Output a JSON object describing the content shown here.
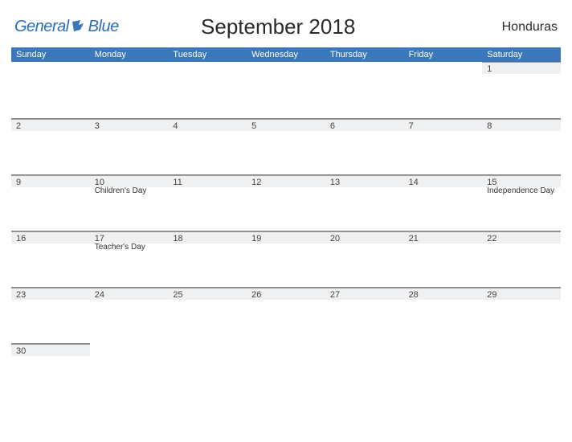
{
  "logo": {
    "part1": "General",
    "part2": "Blue"
  },
  "title": "September 2018",
  "country": "Honduras",
  "weekdays": [
    "Sunday",
    "Monday",
    "Tuesday",
    "Wednesday",
    "Thursday",
    "Friday",
    "Saturday"
  ],
  "weeks": [
    [
      {
        "num": "",
        "event": ""
      },
      {
        "num": "",
        "event": ""
      },
      {
        "num": "",
        "event": ""
      },
      {
        "num": "",
        "event": ""
      },
      {
        "num": "",
        "event": ""
      },
      {
        "num": "",
        "event": ""
      },
      {
        "num": "1",
        "event": ""
      }
    ],
    [
      {
        "num": "2",
        "event": ""
      },
      {
        "num": "3",
        "event": ""
      },
      {
        "num": "4",
        "event": ""
      },
      {
        "num": "5",
        "event": ""
      },
      {
        "num": "6",
        "event": ""
      },
      {
        "num": "7",
        "event": ""
      },
      {
        "num": "8",
        "event": ""
      }
    ],
    [
      {
        "num": "9",
        "event": ""
      },
      {
        "num": "10",
        "event": "Children's Day"
      },
      {
        "num": "11",
        "event": ""
      },
      {
        "num": "12",
        "event": ""
      },
      {
        "num": "13",
        "event": ""
      },
      {
        "num": "14",
        "event": ""
      },
      {
        "num": "15",
        "event": "Independence Day"
      }
    ],
    [
      {
        "num": "16",
        "event": ""
      },
      {
        "num": "17",
        "event": "Teacher's Day"
      },
      {
        "num": "18",
        "event": ""
      },
      {
        "num": "19",
        "event": ""
      },
      {
        "num": "20",
        "event": ""
      },
      {
        "num": "21",
        "event": ""
      },
      {
        "num": "22",
        "event": ""
      }
    ],
    [
      {
        "num": "23",
        "event": ""
      },
      {
        "num": "24",
        "event": ""
      },
      {
        "num": "25",
        "event": ""
      },
      {
        "num": "26",
        "event": ""
      },
      {
        "num": "27",
        "event": ""
      },
      {
        "num": "28",
        "event": ""
      },
      {
        "num": "29",
        "event": ""
      }
    ],
    [
      {
        "num": "30",
        "event": ""
      },
      {
        "num": "",
        "event": ""
      },
      {
        "num": "",
        "event": ""
      },
      {
        "num": "",
        "event": ""
      },
      {
        "num": "",
        "event": ""
      },
      {
        "num": "",
        "event": ""
      },
      {
        "num": "",
        "event": ""
      }
    ]
  ]
}
